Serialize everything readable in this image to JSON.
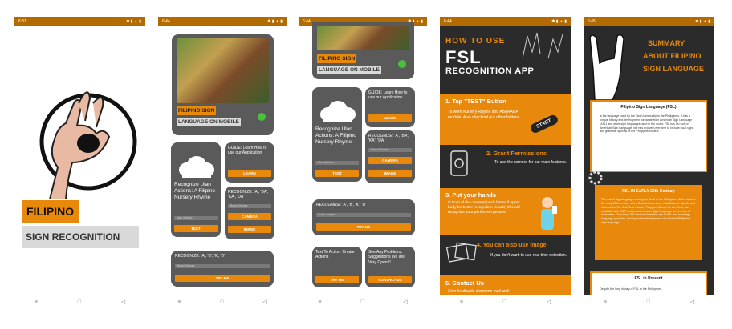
{
  "status": {
    "time1": "6:31",
    "time2": "6:44",
    "time3": "6:44",
    "time4": "6:44",
    "time5": "6:45"
  },
  "nav": {
    "menu": "≡",
    "home": "□",
    "back": "◁"
  },
  "screen1": {
    "brand_line1": "FILIPINO",
    "brand_line2": "SIGN RECOGNITION"
  },
  "screen2": {
    "banner_label1": "FILIPINO SIGN",
    "banner_label2": "LANGUAGE ON MOBILE",
    "nursery_title": "Recognize Ulan Actions: A Filipino Nursery Rhyme",
    "nursery_hint": "Ulan Actions",
    "nursery_btn": "TEST",
    "guide_text": "GUIDE: Learn How to use our Application",
    "guide_btn": "LEARN",
    "abc_text": "RECOGNIZE: 'A', 'BA', 'KA', 'DA'",
    "abc_hint": "Basic Shapes",
    "camera_btn": "CAMERA",
    "image_btn": "IMAGE",
    "abkd_text": "RECOGNIZE: 'A', 'B', 'K', 'D'",
    "abkd_hint": "Basic Shapes",
    "tryme_btn": "TRY ME"
  },
  "screen3": {
    "banner_label1": "FILIPINO SIGN",
    "banner_label2": "LANGUAGE ON MOBILE",
    "nursery_title": "Recognize Ulan Actions: A Filipino Nursery Rhyme",
    "nursery_hint": "Ulan Actions",
    "nursery_btn": "TEST",
    "guide_text": "GUIDE: Learn How to use our Application",
    "guide_btn": "LEARN",
    "abc_text": "RECOGNIZE: 'A', 'BA', 'KA', 'DA'",
    "abc_hint": "Basic Shapes",
    "camera_btn": "CAMERA",
    "image_btn": "IMAGE",
    "abkd_text": "RECOGNIZE: 'A', 'B', 'K', 'D'",
    "abkd_hint": "Basic Shapes",
    "tryme_btn": "TRY ME",
    "tta_text": "Text To Action: Create Actions",
    "tta_btn": "TRY ME",
    "contact_text": "See Any Problems, Suggestions We are Very Open !!",
    "contact_btn": "CONTACT US"
  },
  "screen4": {
    "heading_small": "HOW TO USE",
    "heading_big": "FSL",
    "heading_sub": "RECOGNITION APP",
    "step1_title": "1. Tap \"TEST\" Button",
    "step1_body": "To work Nursery Rhyme and ABAKADA module. Also checkout our other buttons.",
    "start_badge": "START",
    "step2_title": "2. Grant Permissions",
    "step2_body": "To use the camera for our main features.",
    "step3_title": "3. Put your hands",
    "step3_body": "in front of the camera(much better if upper body for better recognition results) this will recognize your performed gesture.",
    "step4_title": "4. You can also use image",
    "step4_body": "If you don't want to use real time detection.",
    "step5_title": "5. Contact Us",
    "step5_body": "Give feedback, shoot me mail and"
  },
  "screen5": {
    "title_line1": "SUMMARY",
    "title_line2": "ABOUT FILIPINO",
    "title_line3": "SIGN LANGUAGE",
    "card1_title": "Filipino Sign Language (FSL)",
    "card1_body": "is the language used by the Deaf community in the Philippines. It has a unique history and development separate from American Sign Language (ASL) and other sign languages used in the world. FSL has its roots in American Sign Language, but has evolved over time to include local signs and grammar specific to the Philippine context.",
    "card2_title": "FSL IN EARLY 20th Century",
    "card2_body": "The use of sign language among the Deaf in the Philippines dates back to the early 20th century, when Deaf schools were established in Manila and other cities. The first Deaf school, Philippine School for the Deaf, was established in 1907 and used American Sign Language as its mode of instruction. Over time, FSL evolved from the use of ASL and local sign language practices, leading to the development of a distinct Philippine sign language.",
    "card3_title": "FSL in Present",
    "card3_body": "Despite the long history of FSL in the Philippines,"
  },
  "colors": {
    "orange": "#e8890c",
    "dark": "#2b2b2b",
    "status": "#b36b00",
    "card": "#5a5a5a"
  }
}
